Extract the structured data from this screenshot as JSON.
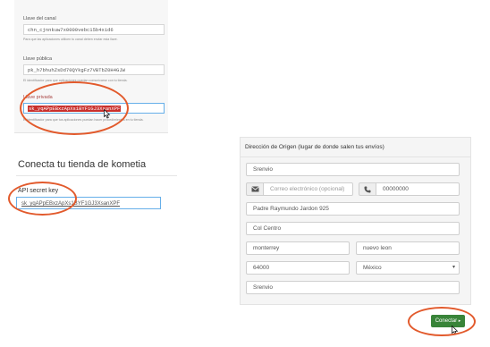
{
  "channel": {
    "label": "Llave del canal",
    "value": "chn_cjnnkuw7x0000vebc15b4xid6",
    "help": "Para que las aplicaciones utilicen tu canal deben enviar esta llave."
  },
  "public_key": {
    "label": "Llave pública",
    "value": "pk_h7bhuhZsDd70QYkgFz7VBTbZ0H4GJW",
    "help": "El identificador para que aplicaciones puedan comunicarse con tu tienda."
  },
  "private_key": {
    "label": "Llave privada",
    "value": "sk_yqAPpEBxzApXs1BYF1GJ3XsanXPF",
    "help": "El identificador para que tus aplicaciones puedan hacer procedimientos en tu tienda."
  },
  "kometia": {
    "title": "Conecta tu tienda de kometia",
    "api_label": "API secret key",
    "api_value": "sk_yqAPpEBxzApXs1BYF1GJ3XsanXPF"
  },
  "address": {
    "heading": "Dirección de Origen (lugar de donde salen tus envíos)",
    "name": "Srenvio",
    "email_placeholder": "Correo electrónico (opcional)",
    "phone": "00000000",
    "street": "Padre Raymundo Jardon 925",
    "colony": "Col Centro",
    "city": "monterrey",
    "state": "nuevo leon",
    "zip": "64000",
    "country": "México",
    "reference": "Srenvio"
  },
  "connect_label": "Conectar",
  "colors": {
    "accent_ring": "#e25a2c",
    "button": "#398439",
    "focus": "#66afe9"
  },
  "icons": [
    "envelope-icon",
    "phone-icon",
    "chevron-right-icon",
    "cursor-icon",
    "caret-down-icon"
  ]
}
